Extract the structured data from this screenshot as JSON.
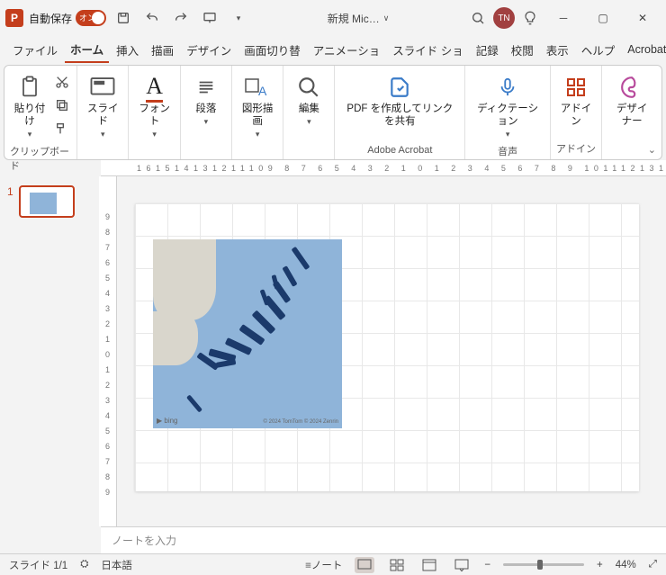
{
  "titlebar": {
    "autosave_label": "自動保存",
    "autosave_on": "オン",
    "doc_title": "新規 Mic…",
    "user_initials": "TN"
  },
  "tabs": {
    "file": "ファイル",
    "home": "ホーム",
    "insert": "挿入",
    "draw": "描画",
    "design": "デザイン",
    "transitions": "画面切り替",
    "animations": "アニメーショ",
    "slideshow": "スライド ショ",
    "record": "記録",
    "review": "校閲",
    "view": "表示",
    "help": "ヘルプ",
    "acrobat": "Acrobat"
  },
  "ribbon": {
    "paste": "貼り付け",
    "clipboard_group": "クリップボード",
    "slides": "スライド",
    "font": "フォント",
    "paragraph": "段落",
    "drawing": "図形描画",
    "editing": "編集",
    "pdf": "PDF を作成してリンクを共有",
    "acrobat_group": "Adobe Acrobat",
    "dictation": "ディクテーション",
    "voice_group": "音声",
    "addins": "アドイン",
    "addins_group": "アドイン",
    "designer": "デザイナー"
  },
  "ruler_h": "161514131211109 8 7 6 5 4 3 2 1 0 1 2 3 4 5 6 7 8 9 101112131415 16",
  "ruler_v": [
    "9",
    "8",
    "7",
    "6",
    "5",
    "4",
    "3",
    "2",
    "1",
    "0",
    "1",
    "2",
    "3",
    "4",
    "5",
    "6",
    "7",
    "8",
    "9"
  ],
  "thumb": {
    "number": "1"
  },
  "map": {
    "bing": "▶ bing",
    "copyright": "© 2024 TomTom  © 2024 Zenrin"
  },
  "notes": {
    "placeholder": "ノートを入力"
  },
  "status": {
    "slide": "スライド 1/1",
    "lang": "日本語",
    "notes_btn": "ノート",
    "zoom": "44%"
  }
}
